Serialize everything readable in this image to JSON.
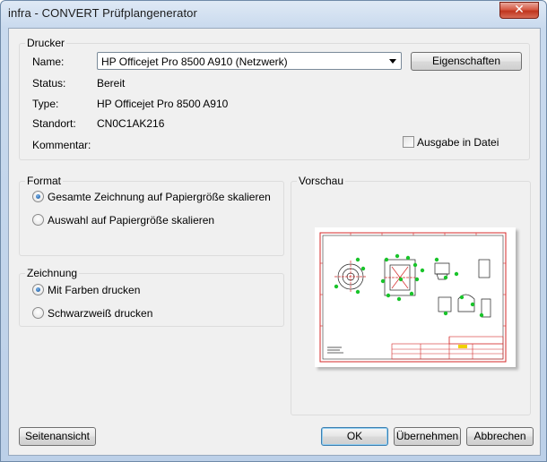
{
  "window": {
    "title": "infra - CONVERT Prüfplangenerator",
    "close_glyph": "✕"
  },
  "printer": {
    "group_label": "Drucker",
    "name_label": "Name:",
    "name_value": "HP Officejet Pro 8500 A910 (Netzwerk)",
    "properties_button": "Eigenschaften",
    "status_label": "Status:",
    "status_value": "Bereit",
    "type_label": "Type:",
    "type_value": "HP Officejet Pro 8500 A910",
    "location_label": "Standort:",
    "location_value": "CN0C1AK216",
    "comment_label": "Kommentar:",
    "print_to_file_label": "Ausgabe in Datei",
    "print_to_file_checked": false
  },
  "format": {
    "group_label": "Format",
    "options": [
      {
        "label": "Gesamte Zeichnung auf Papiergröße skalieren",
        "checked": true
      },
      {
        "label": "Auswahl auf Papiergröße skalieren",
        "checked": false
      }
    ]
  },
  "drawing": {
    "group_label": "Zeichnung",
    "options": [
      {
        "label": "Mit Farben drucken",
        "checked": true
      },
      {
        "label": "Schwarzweiß drucken",
        "checked": false
      }
    ]
  },
  "preview": {
    "group_label": "Vorschau"
  },
  "buttons": {
    "page_view": "Seitenansicht",
    "ok": "OK",
    "apply": "Übernehmen",
    "cancel": "Abbrechen"
  },
  "colors": {
    "frame_red": "#d42a2a",
    "marker_green": "#19c42a",
    "accent_blue": "#3c7fb1"
  }
}
